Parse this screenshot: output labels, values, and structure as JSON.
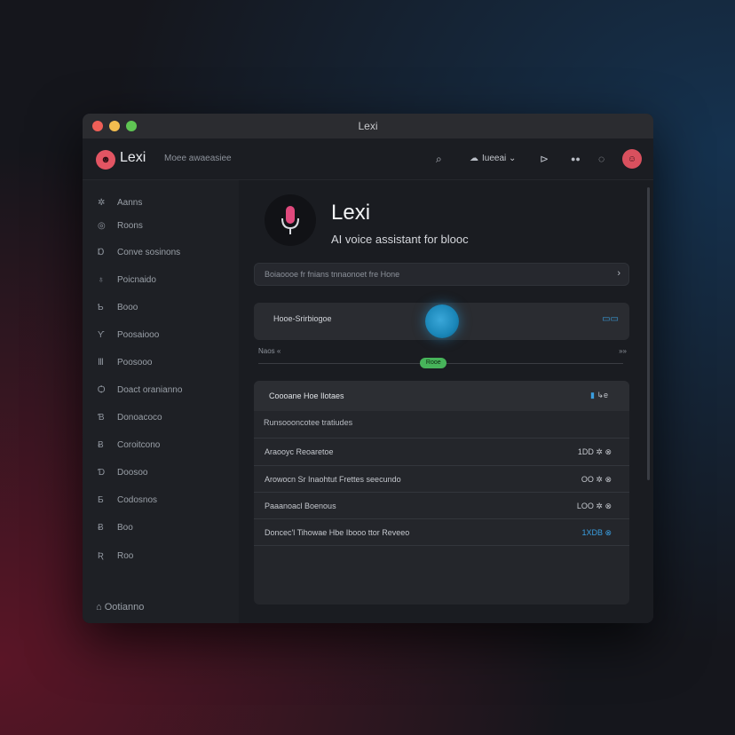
{
  "window": {
    "title": "Lexi"
  },
  "header": {
    "logo_glyph": "☻",
    "app_name": "Lexi",
    "subtitle": "Moee awaeasiee",
    "search_icon": "⌕",
    "dropdown_icon": "☁",
    "dropdown_label": "Iueeai ⌄",
    "broadcast_icon": "⊳",
    "users_icon": "●●",
    "chat_icon": "◌",
    "avatar_glyph": "☺"
  },
  "sidebar": {
    "items": [
      {
        "icon": "✲",
        "label": "Aanns",
        "icon_name": "star-icon"
      },
      {
        "icon": "◎",
        "label": "Roons",
        "icon_name": "target-icon"
      },
      {
        "icon": "Ɒ",
        "label": "Conve sosinons",
        "icon_name": "conversations-icon"
      },
      {
        "icon": "♁",
        "label": "Poicnaido",
        "icon_name": "globe-icon"
      },
      {
        "icon": "Ƅ",
        "label": "Booo",
        "icon_name": "book-icon"
      },
      {
        "icon": "Ƴ",
        "label": "Poosaiooo",
        "icon_name": "filter-icon"
      },
      {
        "icon": "Ⅲ",
        "label": "Poosooo",
        "icon_name": "bars-icon"
      },
      {
        "icon": "Ѻ",
        "label": "Doact oranianno",
        "icon_name": "document-icon"
      },
      {
        "icon": "Ɓ",
        "label": "Donoacoco",
        "icon_name": "contacts-icon"
      },
      {
        "icon": "Ƀ",
        "label": "Coroitcono",
        "icon_name": "settings-icon"
      },
      {
        "icon": "Ɗ",
        "label": "Doosoo",
        "icon_name": "devices-icon"
      },
      {
        "icon": "Ƃ",
        "label": "Codosnos",
        "icon_name": "code-icon"
      },
      {
        "icon": "Ƀ",
        "label": "Boo",
        "icon_name": "box-icon"
      },
      {
        "icon": "Ʀ",
        "label": "Roo",
        "icon_name": "reports-icon"
      }
    ],
    "footer_icon": "⌂",
    "footer_label": "Ootianno"
  },
  "hero": {
    "title": "Lexi",
    "subtitle": "AI voice assistant for blooc"
  },
  "search": {
    "placeholder": "Boiaoooe fr fnians tnnaonoet fre Hone",
    "arrow": "›"
  },
  "voice": {
    "label": "Hooe-Srirbiogoe",
    "icon": "▭▭"
  },
  "progress": {
    "left": "Naos «",
    "right": "»»",
    "badge": "Rooe",
    "level": 0.48
  },
  "list": {
    "title": "Coooane Hoe Ilotaes",
    "right_icon": "▮",
    "right_text": "↳e",
    "subheader": "Runsoooncotee tratiudes",
    "rows": [
      {
        "text": "Araooyc Reoaretoe",
        "value": "1DD ✲ ⊗",
        "highlight": false
      },
      {
        "text": "Arowocn Sr Inaohtut Frettes seecundo",
        "value": "OO ✲ ⊗",
        "highlight": false
      },
      {
        "text": "Paaanoacl Boenous",
        "value": "LOO ✲ ⊗",
        "highlight": false
      },
      {
        "text": "Doncec'l Tihowae Hbe Ibooo ttor Reveeo",
        "value": "1XDB ⊗",
        "highlight": true
      }
    ]
  },
  "colors": {
    "accent_pink": "#e25563",
    "accent_blue": "#3a9ee0",
    "accent_green": "#47b45a",
    "window_bg": "#1b1d22"
  }
}
